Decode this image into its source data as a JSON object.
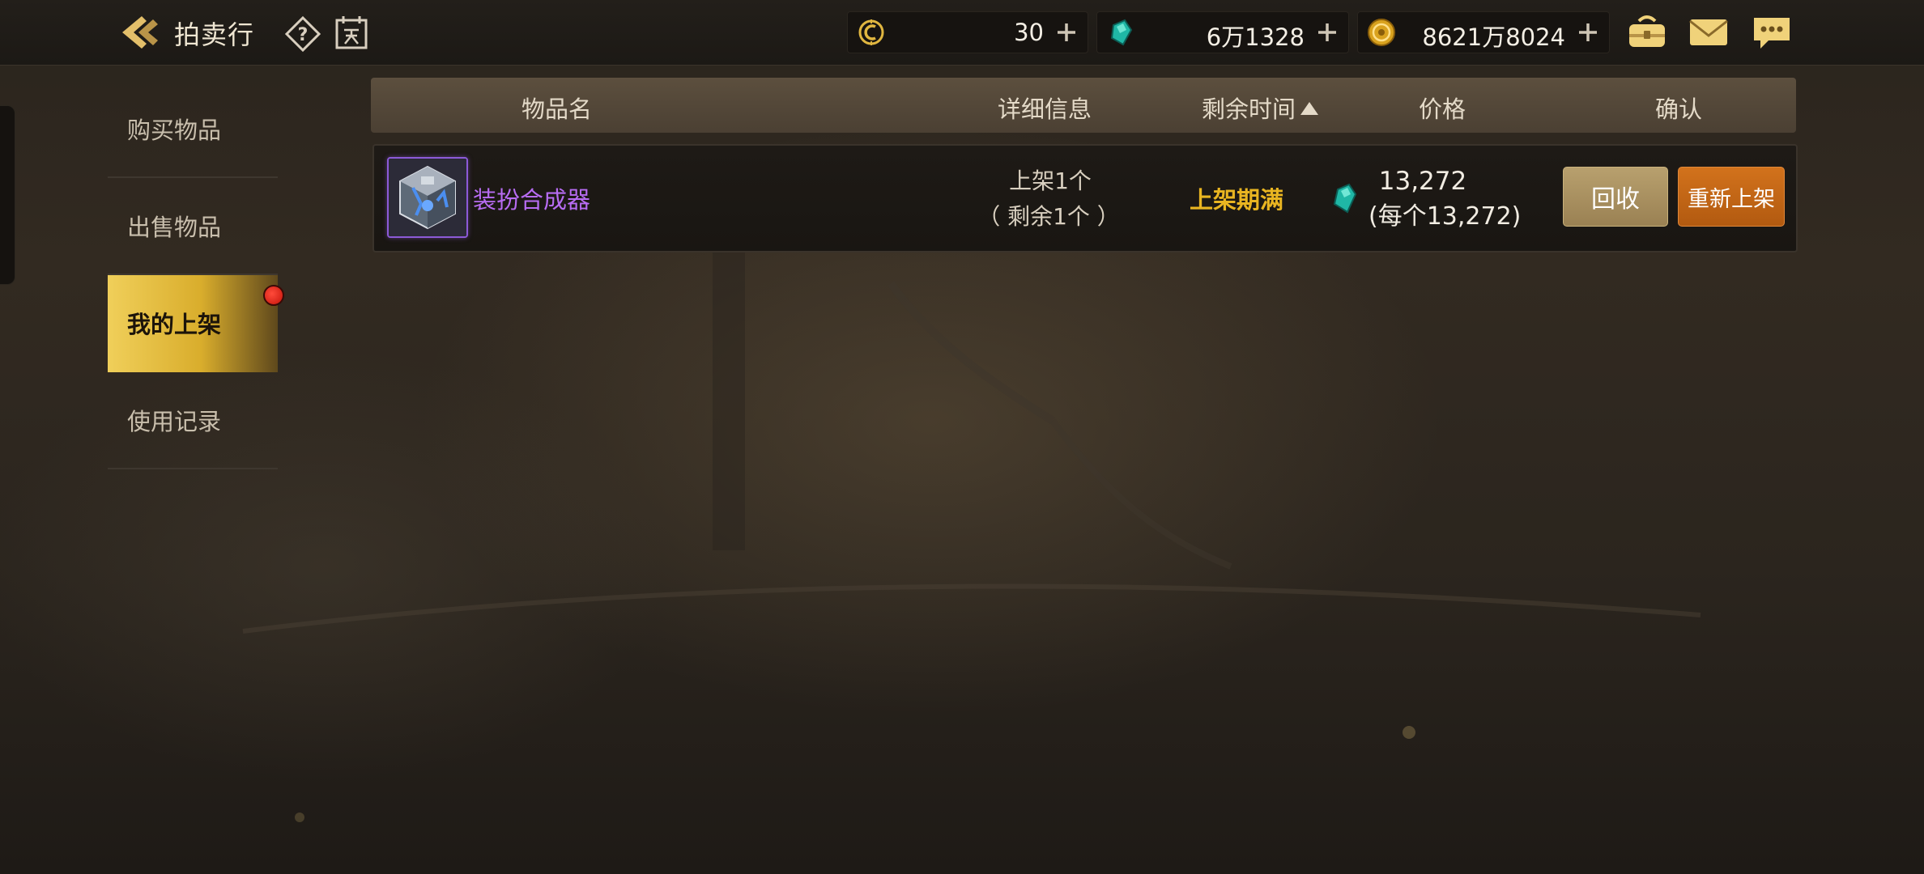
{
  "header": {
    "title": "拍卖行",
    "icons": [
      "back-arrow-icon",
      "help-icon",
      "calendar-icon"
    ]
  },
  "currencies": [
    {
      "name": "coupon",
      "icon": "coupon-coin-icon",
      "value": "30"
    },
    {
      "name": "gem",
      "icon": "teal-gem-icon",
      "value": "6万1328"
    },
    {
      "name": "gold",
      "icon": "gold-coin-icon",
      "value": "8621万8024"
    }
  ],
  "top_actions": [
    "inventory-bag-icon",
    "mail-icon",
    "chat-icon"
  ],
  "sidebar": {
    "items": [
      {
        "label": "购买物品"
      },
      {
        "label": "出售物品"
      },
      {
        "label": "我的上架",
        "active": true,
        "has_notification": true
      },
      {
        "label": "使用记录"
      }
    ]
  },
  "table": {
    "headers": {
      "name": "物品名",
      "details": "详细信息",
      "remaining_time": "剩余时间",
      "price": "价格",
      "confirm": "确认"
    },
    "sort": {
      "column": "remaining_time",
      "direction": "ascending"
    },
    "rows": [
      {
        "item_name": "装扮合成器",
        "item_icon": "cube-synthesizer-icon",
        "rarity_color": "#b76cf2",
        "detail_listed": "上架1个",
        "detail_remaining": "（ 剩余1个 ）",
        "status": "上架期满",
        "price_icon": "teal-gem-icon",
        "price_total": "13,272",
        "price_each": "(每个13,272)",
        "recall_label": "回收",
        "relist_label": "重新上架"
      }
    ]
  },
  "colors": {
    "accent_gold": "#e9b521",
    "item_purple": "#b76cf2",
    "relist_orange": "#c8661a",
    "recall_tan": "#a98f5e"
  }
}
